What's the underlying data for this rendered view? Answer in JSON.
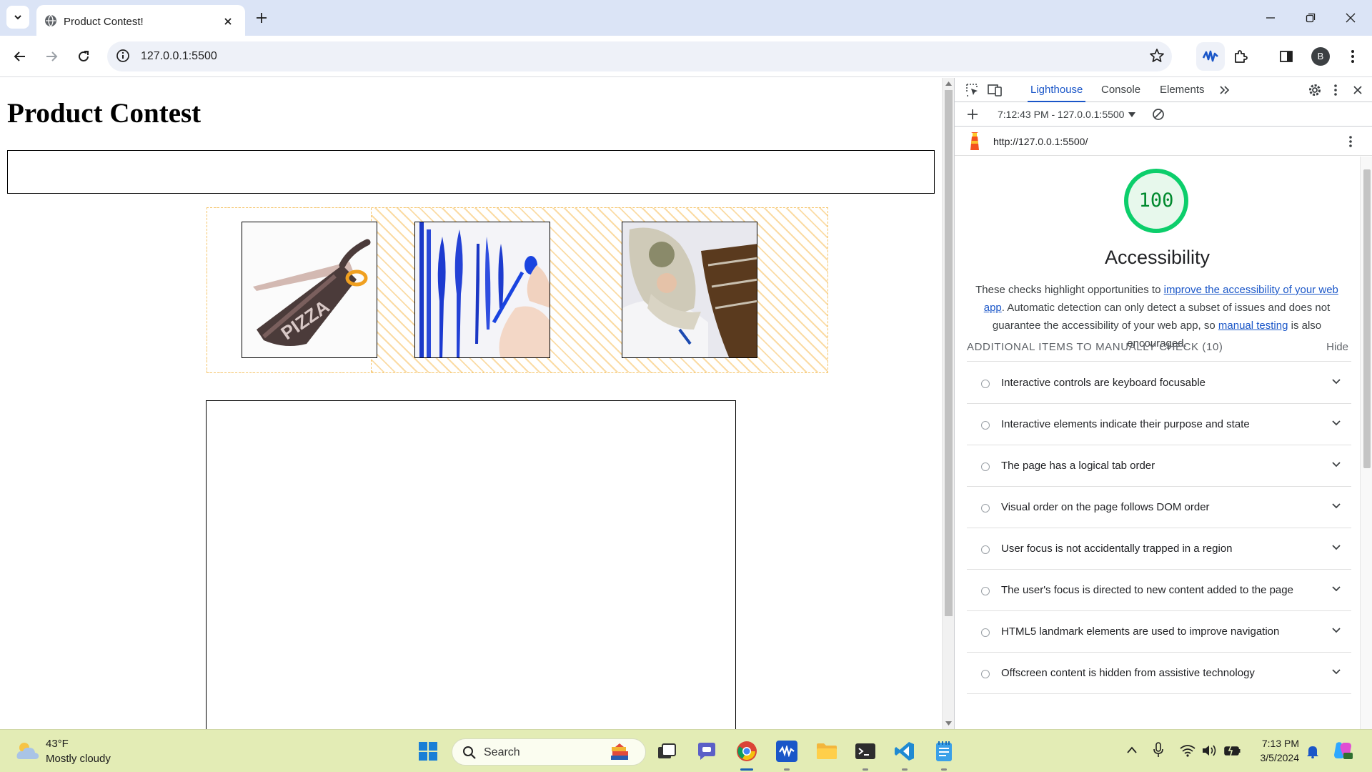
{
  "browser": {
    "tab_title": "Product Contest!",
    "url": "127.0.0.1:5500",
    "profile_initial": "B"
  },
  "page": {
    "heading": "Product Contest",
    "gallery": [
      {
        "subject": "pizza-scissors"
      },
      {
        "subject": "blue-cutlery"
      },
      {
        "subject": "sleeping-bag"
      }
    ]
  },
  "devtools": {
    "tabs": [
      "Lighthouse",
      "Console",
      "Elements"
    ],
    "active_tab": "Lighthouse",
    "report_label": "7:12:43 PM - 127.0.0.1:5500",
    "report_url": "http://127.0.0.1:5500/",
    "score": "100",
    "score_fraction": 1.0,
    "score_color": "#0cce6b",
    "category": "Accessibility",
    "desc_pre": "These checks highlight opportunities to ",
    "desc_link1": "improve the accessibility of your web app",
    "desc_mid": ". Automatic detection can only detect a subset of issues and does not guarantee the accessibility of your web app, so ",
    "desc_link2": "manual testing",
    "desc_post": " is also encouraged.",
    "group_title": "ADDITIONAL ITEMS TO MANUALLY CHECK (10)",
    "hide_label": "Hide",
    "items": [
      "Interactive controls are keyboard focusable",
      "Interactive elements indicate their purpose and state",
      "The page has a logical tab order",
      "Visual order on the page follows DOM order",
      "User focus is not accidentally trapped in a region",
      "The user's focus is directed to new content added to the page",
      "HTML5 landmark elements are used to improve navigation",
      "Offscreen content is hidden from assistive technology"
    ]
  },
  "taskbar": {
    "temperature": "43°F",
    "weather": "Mostly cloudy",
    "search_label": "Search",
    "time": "7:13 PM",
    "date": "3/5/2024"
  },
  "colors": {
    "accent": "#1a56c8",
    "tabbar": "#dbe4f6",
    "taskbar": "#e3ecb5",
    "gallery_border": "#f5c56b"
  }
}
